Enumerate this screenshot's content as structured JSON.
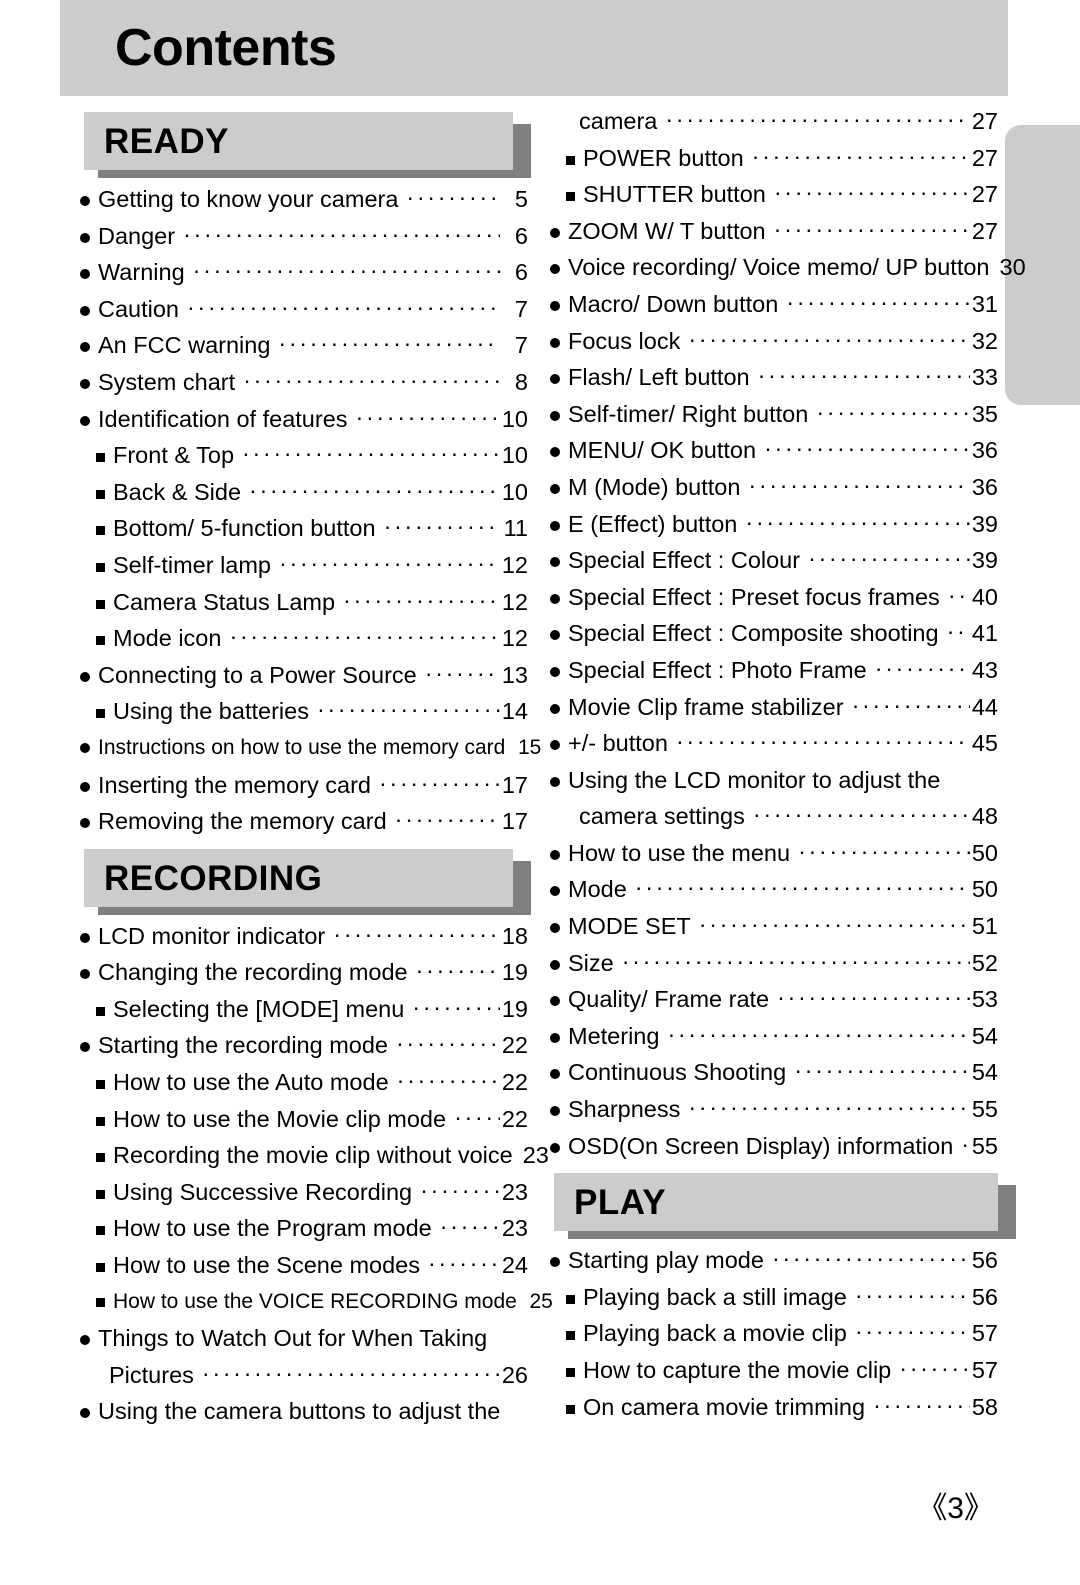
{
  "page": {
    "title": "Contents",
    "page_number": "《3》"
  },
  "left_column": [
    {
      "type": "section",
      "name": "READY",
      "entries": [
        {
          "level": 1,
          "label": "Getting to know your camera",
          "page": "5"
        },
        {
          "level": 1,
          "label": "Danger",
          "page": "6"
        },
        {
          "level": 1,
          "label": "Warning",
          "page": "6"
        },
        {
          "level": 1,
          "label": "Caution",
          "page": "7"
        },
        {
          "level": 1,
          "label": "An FCC warning",
          "page": "7"
        },
        {
          "level": 1,
          "label": "System chart",
          "page": "8"
        },
        {
          "level": 1,
          "label": "Identification of features",
          "page": "10"
        },
        {
          "level": 2,
          "label": "Front & Top",
          "page": "10"
        },
        {
          "level": 2,
          "label": "Back & Side",
          "page": "10"
        },
        {
          "level": 2,
          "label": "Bottom/ 5-function button",
          "page": "11"
        },
        {
          "level": 2,
          "label": "Self-timer lamp",
          "page": "12"
        },
        {
          "level": 2,
          "label": "Camera Status Lamp",
          "page": "12"
        },
        {
          "level": 2,
          "label": "Mode icon",
          "page": "12"
        },
        {
          "level": 1,
          "label": "Connecting to a Power Source",
          "page": "13"
        },
        {
          "level": 2,
          "label": "Using the batteries",
          "page": "14"
        },
        {
          "level": 1,
          "label": "Instructions on how to use the memory card",
          "page": "15",
          "condensed": true
        },
        {
          "level": 1,
          "label": "Inserting the memory card",
          "page": "17"
        },
        {
          "level": 1,
          "label": "Removing the memory card",
          "page": "17"
        }
      ]
    },
    {
      "type": "section",
      "name": "RECORDING",
      "entries": [
        {
          "level": 1,
          "label": "LCD monitor indicator",
          "page": "18"
        },
        {
          "level": 1,
          "label": "Changing the recording mode",
          "page": "19"
        },
        {
          "level": 2,
          "label": "Selecting the [MODE] menu",
          "page": "19"
        },
        {
          "level": 1,
          "label": "Starting the recording mode",
          "page": "22"
        },
        {
          "level": 2,
          "label": "How to use the Auto mode",
          "page": "22"
        },
        {
          "level": 2,
          "label": "How to use the Movie clip mode",
          "page": "22"
        },
        {
          "level": 2,
          "label": "Recording the movie clip without voice",
          "page": "23"
        },
        {
          "level": 2,
          "label": "Using Successive Recording",
          "page": "23"
        },
        {
          "level": 2,
          "label": "How to use the Program mode",
          "page": "23"
        },
        {
          "level": 2,
          "label": "How to use the Scene modes",
          "page": "24"
        },
        {
          "level": 2,
          "label": "How to use the VOICE RECORDING mode",
          "page": "25",
          "condensed": true
        },
        {
          "level": 1,
          "label": "Things to Watch Out for When Taking",
          "page": "",
          "noleader": true
        },
        {
          "level": 0,
          "label": "Pictures",
          "page": "26"
        },
        {
          "level": 1,
          "label": "Using the camera buttons to adjust the",
          "page": "",
          "noleader": true
        }
      ]
    }
  ],
  "right_column": [
    {
      "type": "plain",
      "entries": [
        {
          "level": 0,
          "label": "camera",
          "page": "27"
        },
        {
          "level": 2,
          "label": "POWER button",
          "page": "27"
        },
        {
          "level": 2,
          "label": "SHUTTER button",
          "page": "27"
        },
        {
          "level": 1,
          "label": "ZOOM W/ T button",
          "page": "27"
        },
        {
          "level": 1,
          "label": "Voice recording/ Voice memo/ UP button",
          "page": "30"
        },
        {
          "level": 1,
          "label": "Macro/ Down button",
          "page": "31"
        },
        {
          "level": 1,
          "label": "Focus lock",
          "page": "32"
        },
        {
          "level": 1,
          "label": "Flash/ Left button",
          "page": "33"
        },
        {
          "level": 1,
          "label": "Self-timer/ Right button",
          "page": "35"
        },
        {
          "level": 1,
          "label": "MENU/ OK button",
          "page": "36"
        },
        {
          "level": 1,
          "label": "M (Mode) button",
          "page": "36"
        },
        {
          "level": 1,
          "label": "E (Effect) button",
          "page": "39"
        },
        {
          "level": 1,
          "label": "Special Effect : Colour",
          "page": "39"
        },
        {
          "level": 1,
          "label": "Special Effect : Preset focus frames",
          "page": "40"
        },
        {
          "level": 1,
          "label": "Special Effect : Composite shooting",
          "page": "41"
        },
        {
          "level": 1,
          "label": "Special Effect : Photo Frame",
          "page": "43"
        },
        {
          "level": 1,
          "label": "Movie Clip frame stabilizer",
          "page": "44"
        },
        {
          "level": 1,
          "label": "+/- button",
          "page": "45"
        },
        {
          "level": 1,
          "label": "Using the LCD monitor to adjust the",
          "page": "",
          "noleader": true
        },
        {
          "level": 0,
          "label": "camera settings",
          "page": "48"
        },
        {
          "level": 1,
          "label": "How to use the menu",
          "page": "50"
        },
        {
          "level": 1,
          "label": "Mode",
          "page": "50"
        },
        {
          "level": 1,
          "label": "MODE SET",
          "page": "51"
        },
        {
          "level": 1,
          "label": "Size",
          "page": "52"
        },
        {
          "level": 1,
          "label": "Quality/ Frame rate",
          "page": "53"
        },
        {
          "level": 1,
          "label": "Metering",
          "page": "54"
        },
        {
          "level": 1,
          "label": "Continuous Shooting",
          "page": "54"
        },
        {
          "level": 1,
          "label": "Sharpness",
          "page": "55"
        },
        {
          "level": 1,
          "label": "OSD(On Screen Display) information",
          "page": "55"
        }
      ]
    },
    {
      "type": "section",
      "name": "PLAY",
      "entries": [
        {
          "level": 1,
          "label": "Starting play mode",
          "page": "56"
        },
        {
          "level": 2,
          "label": "Playing back a still image",
          "page": "56"
        },
        {
          "level": 2,
          "label": "Playing back a movie clip",
          "page": "57"
        },
        {
          "level": 2,
          "label": "How to capture the movie clip",
          "page": "57"
        },
        {
          "level": 2,
          "label": "On camera movie trimming",
          "page": "58"
        }
      ]
    }
  ],
  "colors": {
    "plaque_fill": "#cccccc",
    "plaque_shadow": "#808080",
    "band_fill": "#cccccc",
    "text": "#000000"
  }
}
